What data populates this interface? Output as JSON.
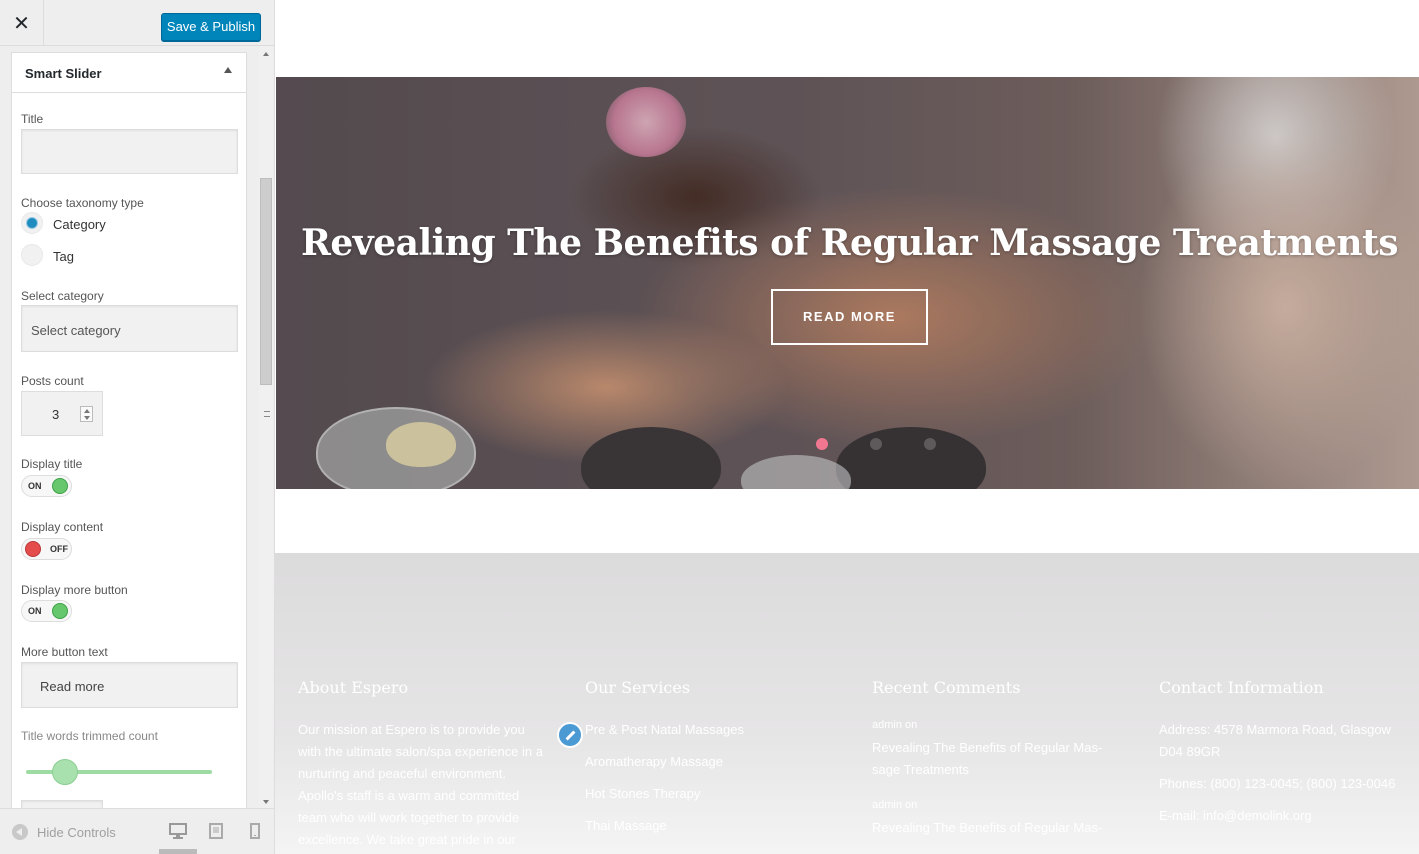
{
  "header": {
    "close_label": "✕",
    "save_label": "Save & Publish"
  },
  "section": {
    "title": "Smart Slider",
    "title_label": "Title",
    "title_value": "",
    "taxonomy_label": "Choose taxonomy type",
    "taxonomy_options": [
      {
        "label": "Category",
        "checked": true
      },
      {
        "label": "Tag",
        "checked": false
      }
    ],
    "select_category_label": "Select category",
    "select_category_value": "Select category",
    "posts_count_label": "Posts count",
    "posts_count_value": "3",
    "display_title_label": "Display title",
    "display_title_state": "ON",
    "display_content_label": "Display content",
    "display_content_state": "OFF",
    "display_more_label": "Display more button",
    "display_more_state": "ON",
    "more_text_label": "More button text",
    "more_text_value": "Read more",
    "trim_label": "Title words trimmed count"
  },
  "footer_bar": {
    "hide_controls": "Hide Controls",
    "devices": [
      "desktop-icon",
      "tablet-icon",
      "mobile-icon"
    ]
  },
  "hero": {
    "title": "Revealing The Benefits of Regular Massage Treatments",
    "button": "READ MORE",
    "active_slide": 1,
    "slide_count": 3
  },
  "footer": {
    "about": {
      "heading": "About Espero",
      "text": "Our mission at Espero is to provide you with the ultimate salon/spa experience in a nurturing and peaceful environment. Apollo's staff is a warm and committed team who will work together to provide excellence. We take great pride in our"
    },
    "services": {
      "heading": "Our Services",
      "items": [
        "Pre & Post Natal Massages",
        "Aromatherapy Massage",
        "Hot Stones Therapy",
        "Thai Massage"
      ]
    },
    "comments": {
      "heading": "Recent Comments",
      "items": [
        {
          "meta": "admin  on",
          "text": "Revealing The Benefits of Regular Mas-sage Treatments"
        },
        {
          "meta": "admin  on",
          "text": "Revealing The Benefits of Regular Mas-"
        }
      ]
    },
    "contact": {
      "heading": "Contact Information",
      "address": "Address: 4578 Marmora Road, Glasgow D04 89GR",
      "phones": "Phones: (800) 123-0045; (800) 123-0046",
      "email": "E-mail: info@demolink.org"
    }
  }
}
